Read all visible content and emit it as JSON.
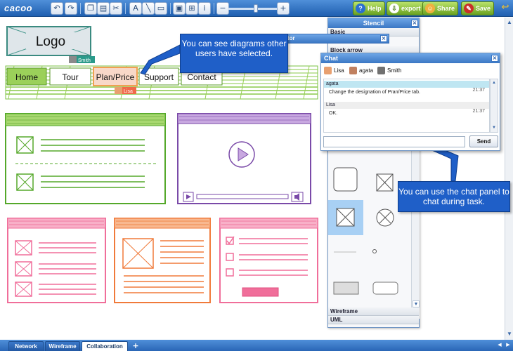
{
  "toolbar": {
    "logo": "cacoo",
    "help_label": "Help",
    "export_label": "export",
    "share_label": "Share",
    "save_label": "Save"
  },
  "canvas": {
    "logo_label": "Logo",
    "nav_items": [
      "Home",
      "Tour",
      "Plan/Price",
      "Support",
      "Contact"
    ],
    "cursor_smith": "Smith",
    "cursor_lisa": "Lisa"
  },
  "stencil": {
    "title": "Stencil",
    "categories_top": [
      "Basic",
      "Block arrow"
    ],
    "categories_bottom": [
      "Wireframe",
      "UML"
    ]
  },
  "properties": {
    "title_partial": "tor"
  },
  "chat": {
    "title": "Chat",
    "users": [
      {
        "name": "Lisa",
        "color": "#e8a070"
      },
      {
        "name": "agata",
        "color": "#c08060"
      },
      {
        "name": "Smith",
        "color": "#707070"
      }
    ],
    "messages": [
      {
        "author": "agata",
        "text": "Change the designation of Pran/Price tab.",
        "time": "21:37"
      },
      {
        "author": "Lisa",
        "text": "OK.",
        "time": "21:37"
      }
    ],
    "input_value": "",
    "send_label": "Send"
  },
  "callouts": {
    "diagrams": "You can see diagrams other users have selected.",
    "chat": "You can use the chat panel to chat during task."
  },
  "pages": {
    "tabs": [
      "Network",
      "Wireframe",
      "Collaboration"
    ],
    "active": "Collaboration",
    "add_label": "+"
  },
  "colors": {
    "green_sketch": "#55a82a",
    "purple_sketch": "#7a4aa8",
    "pink_sketch": "#f06e9a",
    "orange_sketch": "#f07a3a",
    "toolbar_blue": "#2f6fc0",
    "callout_blue": "#1f5fc8"
  }
}
